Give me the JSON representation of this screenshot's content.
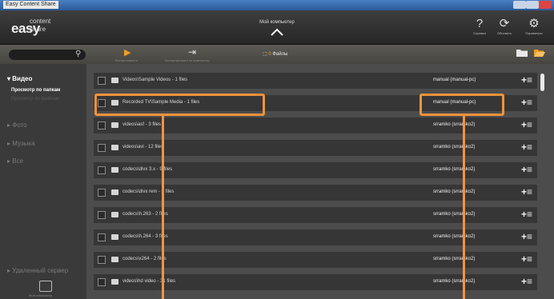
{
  "window": {
    "title": "Easy Content Share"
  },
  "header": {
    "logo_easy": "easy",
    "logo_content": "content",
    "logo_share": "share",
    "center_label": "Мой компьютер",
    "help_label": "Справка",
    "refresh_label": "Обновить",
    "settings_label": "Параметры"
  },
  "toolbar": {
    "search_value": "",
    "play_label": "Воспроизвести",
    "export_label": "Экспортировать на компьютер",
    "files_count": "0",
    "files_label": "Файлы"
  },
  "sidebar": {
    "video": "Видео",
    "by_folder": "Просмотр по папкам",
    "by_file": "Просмотр по файлам",
    "photo": "Фото",
    "music": "Музыка",
    "all": "Все",
    "remote": "Удаленный сервер",
    "mypc": "Мой компьютер"
  },
  "rows": [
    {
      "name": "Videos\\Sample Videos - 1 files",
      "owner": "manual (manual-pc)"
    },
    {
      "name": "Recorded TV\\Sample Media - 1 files",
      "owner": "manual (manual-pc)"
    },
    {
      "name": "videos\\asf - 3 files",
      "owner": "srramko (srramko2)"
    },
    {
      "name": "videos\\avi - 12 files",
      "owner": "srramko (srramko2)"
    },
    {
      "name": "codecs\\divx 3.x - 9 files",
      "owner": "srramko (srramko2)"
    },
    {
      "name": "codecs\\divx rem - 3 files",
      "owner": "srramko (srramko2)"
    },
    {
      "name": "codecs\\h.263 - 2 files",
      "owner": "srramko (srramko2)"
    },
    {
      "name": "codecs\\h.264 - 3 files",
      "owner": "srramko (srramko2)"
    },
    {
      "name": "codecs\\x264 - 2 files",
      "owner": "srramko (srramko2)"
    },
    {
      "name": "videos\\hd video - 31 files",
      "owner": "srramko (srramko2)"
    }
  ],
  "colors": {
    "accent": "#f0a020",
    "highlight": "#f2933c"
  }
}
